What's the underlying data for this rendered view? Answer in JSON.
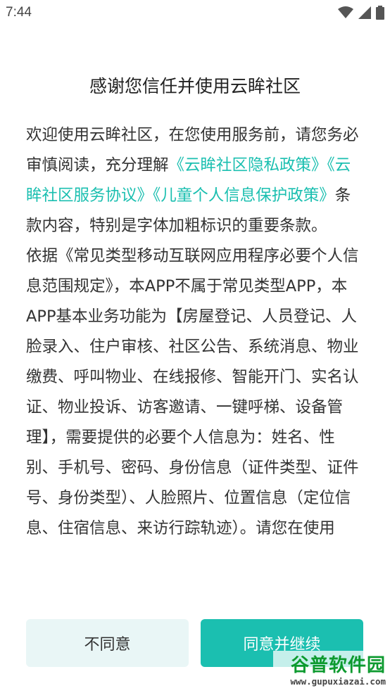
{
  "status_bar": {
    "time": "7:44"
  },
  "dialog": {
    "title": "感谢您信任并使用云眸社区",
    "para1": {
      "text_a": "欢迎使用云眸社区，在您使用服务前，请您务必审慎阅读，充分理解",
      "link_privacy": "《云眸社区隐私政策》",
      "link_service": "《云眸社区服务协议》",
      "link_children": "《儿童个人信息保护政策》",
      "text_b": "条款内容，特别是字体加粗标识的重要条款。"
    },
    "para2": "依据《常见类型移动互联网应用程序必要个人信息范围规定》，本APP不属于常见类型APP，本APP基本业务功能为【房屋登记、人员登记、人脸录入、住户审核、社区公告、系统消息、物业缴费、呼叫物业、在线报修、智能开门、实名认证、物业投诉、访客邀请、一键呼梯、设备管理】，需要提供的必要个人信息为：姓名、性别、手机号、密码、身份信息（证件类型、证件号、身份类型）、人脸照片、位置信息（定位信息、住宿信息、来访行踪轨迹）。请您在使用",
    "buttons": {
      "disagree": "不同意",
      "agree": "同意并继续"
    }
  },
  "watermark": {
    "title": "谷普软件园",
    "url": "www.gupuxiazai.com"
  },
  "colors": {
    "accent": "#1bbfb0",
    "secondary_button_bg": "#e9f6f6"
  }
}
